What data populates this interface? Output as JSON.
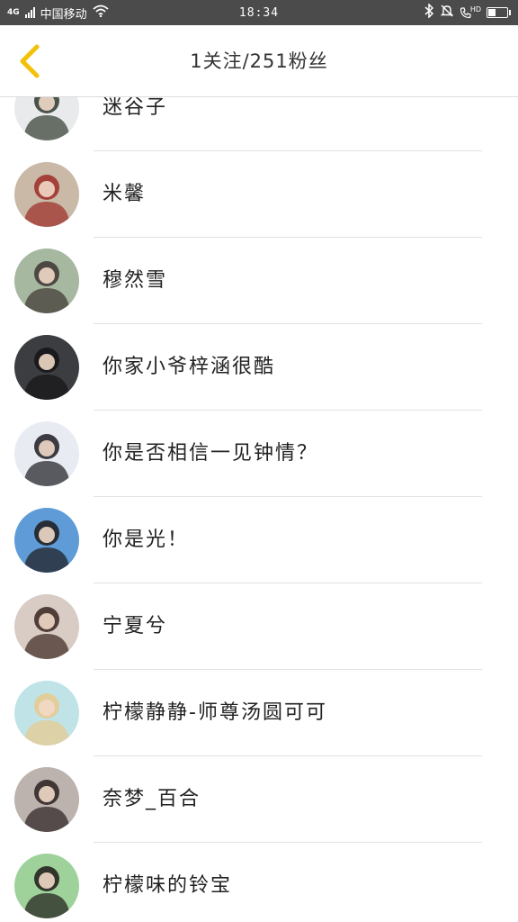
{
  "status_bar": {
    "network": "4G",
    "carrier": "中国移动",
    "time": "18:34",
    "hd_label": "HD",
    "icons": [
      "signal-icon",
      "wifi-icon",
      "bluetooth-icon",
      "mute-icon",
      "hd-call-icon",
      "battery-icon"
    ]
  },
  "header": {
    "title": "1关注/251粉丝",
    "back_icon": "chevron-left-icon",
    "accent": "#f2c20a"
  },
  "users": [
    {
      "name": "迷谷子",
      "avatar_colors": [
        "#e9eaec",
        "#2f3a2f"
      ]
    },
    {
      "name": "米馨",
      "avatar_colors": [
        "#c9b9a6",
        "#9d2b25"
      ]
    },
    {
      "name": "穆然雪",
      "avatar_colors": [
        "#a6b8a0",
        "#3d3431"
      ]
    },
    {
      "name": "你家小爷梓涵很酷",
      "avatar_colors": [
        "#3c3d40",
        "#141416"
      ]
    },
    {
      "name": "你是否相信一见钟情？",
      "avatar_colors": [
        "#e8ecf2",
        "#1c1c22"
      ]
    },
    {
      "name": "你是光！",
      "avatar_colors": [
        "#5f9bd6",
        "#1d1a1a"
      ]
    },
    {
      "name": "宁夏兮",
      "avatar_colors": [
        "#d8ccc4",
        "#3a2520"
      ]
    },
    {
      "name": "柠檬静静-师尊汤圆可可",
      "avatar_colors": [
        "#bfe3e6",
        "#e9c98d"
      ]
    },
    {
      "name": "奈梦_百合",
      "avatar_colors": [
        "#bcb2ae",
        "#2b2021"
      ]
    },
    {
      "name": "柠檬味的铃宝",
      "avatar_colors": [
        "#9fd29a",
        "#1e1a18"
      ]
    }
  ]
}
